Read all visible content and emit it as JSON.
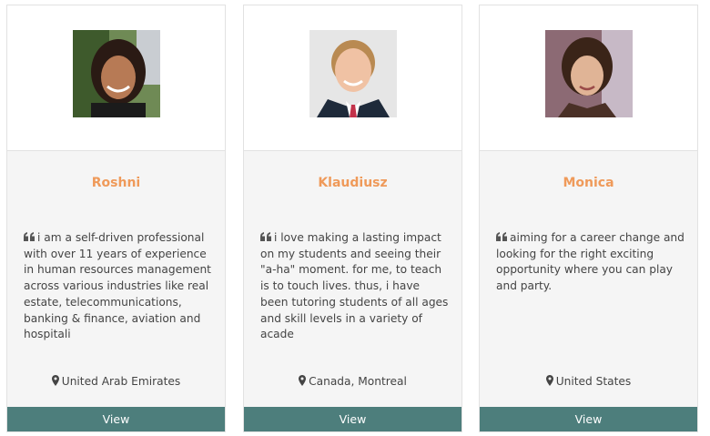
{
  "cards": [
    {
      "name": "Roshni",
      "bio": "i am a self-driven professional with over 11 years of experience in human resources management across various industries like real estate, telecommunications, banking & finance, aviation and hospitali",
      "location": "United Arab Emirates",
      "button_label": "View"
    },
    {
      "name": "Klaudiusz",
      "bio": "i love making a lasting impact on my students and seeing their \"a-ha\" moment. for me, to teach is to touch lives. thus, i have been tutoring students of all ages and skill levels in a variety of acade",
      "location": "Canada, Montreal",
      "button_label": "View"
    },
    {
      "name": "Monica",
      "bio": "aiming for a career change and looking for the right exciting opportunity where you can play and party.",
      "location": "United States",
      "button_label": "View"
    }
  ],
  "icons": {
    "quote": "quote-icon",
    "location": "map-marker-icon",
    "notification": "bell-icon"
  },
  "colors": {
    "name_accent": "#ef9a5a",
    "button_bg": "#4d7e7c",
    "badge_bg": "#0fa3e6"
  }
}
